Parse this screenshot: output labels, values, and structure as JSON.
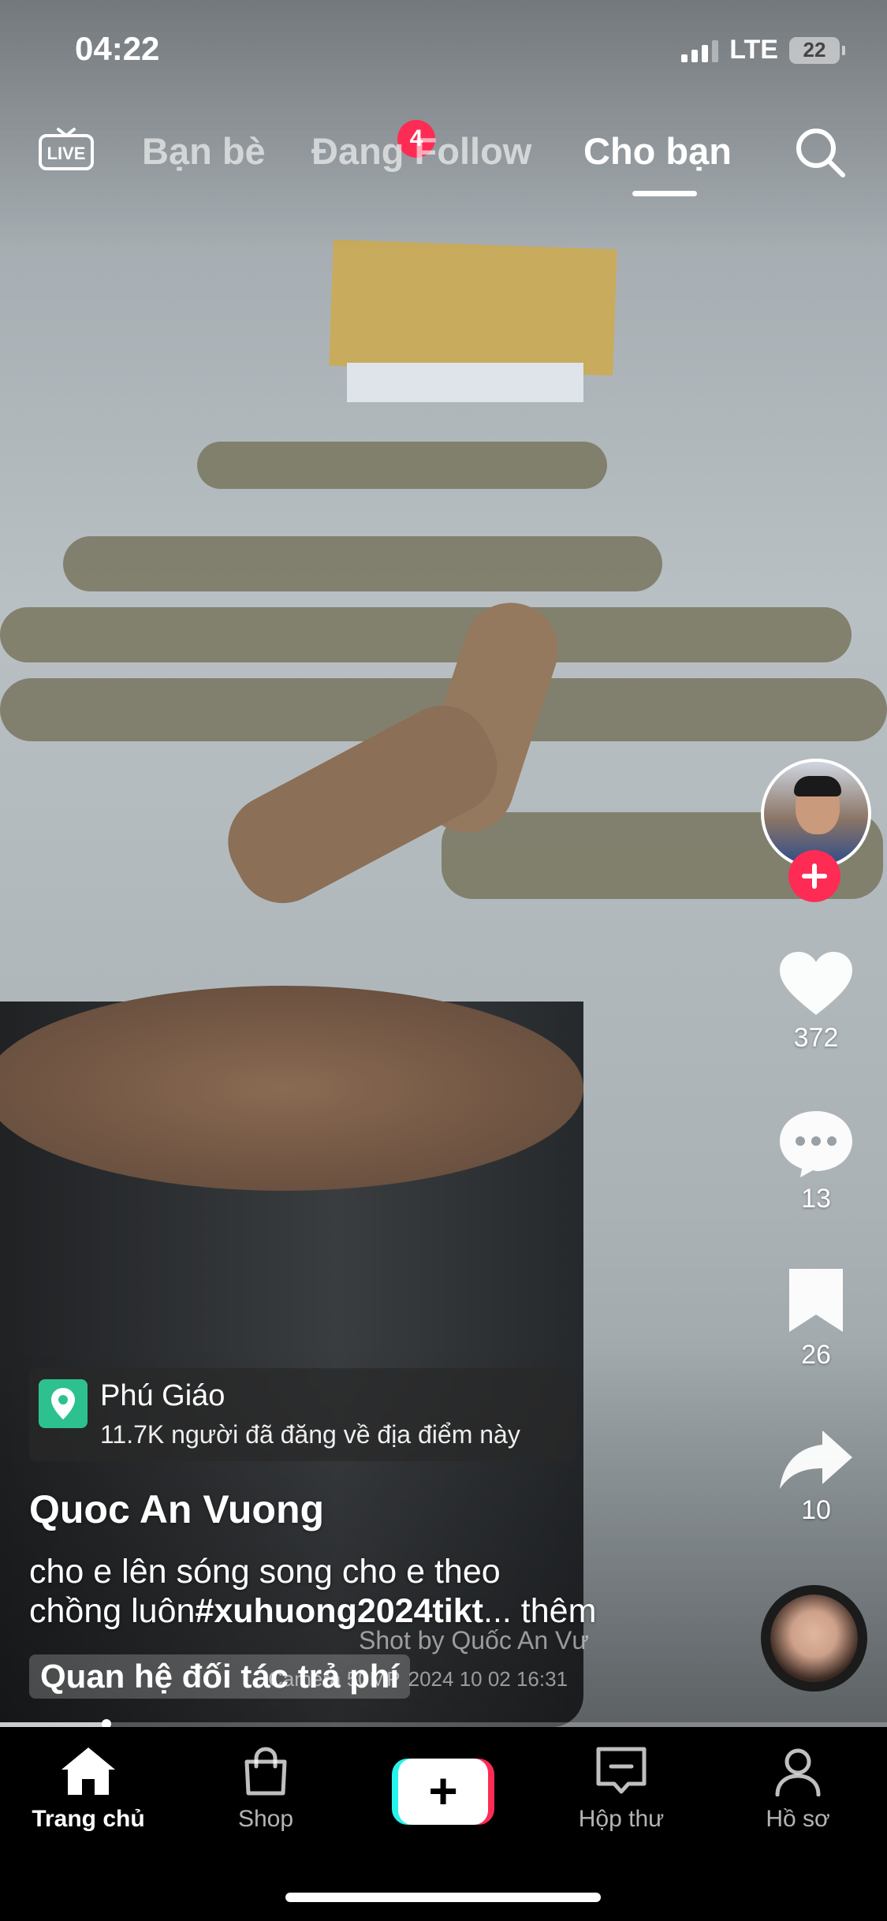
{
  "status_bar": {
    "time": "04:22",
    "network": "LTE",
    "battery": "22"
  },
  "top_nav": {
    "live_label": "LIVE",
    "tabs": [
      {
        "label": "Bạn bè",
        "badge": "4"
      },
      {
        "label": "Đang Follow"
      },
      {
        "label": "Cho bạn",
        "active": true
      }
    ]
  },
  "video": {
    "location": {
      "name": "Phú Giáo",
      "subtitle": "11.7K người đã đăng về địa điểm này"
    },
    "author": "Quoc An Vuong",
    "caption_line1": "cho e lên sóng song cho e theo",
    "caption_line2_text": "chồng luôn",
    "caption_hashtag": "#xuhuong2024tikt",
    "caption_more": "... thêm",
    "paid_label": "Quan hệ đối tác trả phí",
    "watermark_line1": "Shot by Quốc An Vư",
    "watermark_line2": "Camera 50MP",
    "watermark_date": "2024 10 02 16:31",
    "progress": 0.12
  },
  "actions": {
    "likes": "372",
    "comments": "13",
    "saves": "26",
    "shares": "10"
  },
  "bottom_nav": [
    {
      "label": "Trang chủ",
      "icon": "home-icon",
      "active": true
    },
    {
      "label": "Shop",
      "icon": "shopping-bag-icon"
    },
    {
      "label": "",
      "icon": "plus-icon"
    },
    {
      "label": "Hộp thư",
      "icon": "inbox-icon"
    },
    {
      "label": "Hồ sơ",
      "icon": "profile-icon"
    }
  ],
  "colors": {
    "accent": "#fe2c55",
    "cyan": "#25f4ee",
    "location_pin": "#2ec190"
  }
}
